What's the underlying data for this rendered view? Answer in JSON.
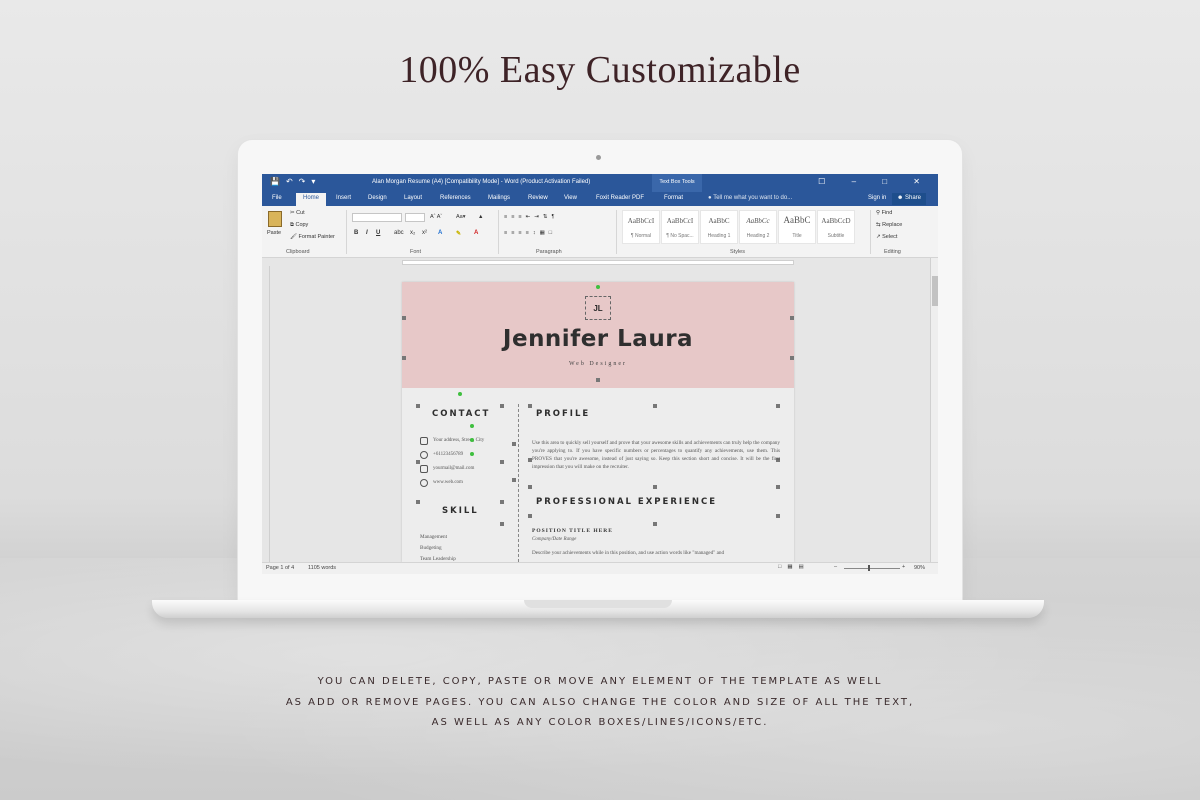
{
  "headline": "100% Easy Customizable",
  "captions": [
    "YOU CAN DELETE, COPY, PASTE OR MOVE ANY ELEMENT OF THE TEMPLATE AS WELL",
    "AS ADD OR REMOVE PAGES. YOU CAN ALSO CHANGE THE COLOR AND SIZE OF ALL THE TEXT,",
    "AS WELL AS ANY COLOR BOXES/LINES/ICONS/ETC."
  ],
  "word": {
    "title": "Alan Morgan Resume (A4) [Compatibility Mode] - Word (Product Activation Failed)",
    "context_tab": "Text Box Tools",
    "window_controls": "☐ – □ ✕",
    "tabs": [
      "File",
      "Home",
      "Insert",
      "Design",
      "Layout",
      "References",
      "Mailings",
      "Review",
      "View",
      "Foxit Reader PDF",
      "Format"
    ],
    "tell_me": "Tell me what you want to do...",
    "sign_in": "Sign in",
    "share": "Share",
    "clipboard": {
      "paste": "Paste",
      "cut": "Cut",
      "copy": "Copy",
      "format_painter": "Format Painter",
      "label": "Clipboard"
    },
    "font_label": "Font",
    "paragraph_label": "Paragraph",
    "styles_label": "Styles",
    "styles": [
      {
        "sample": "AaBbCcI",
        "name": "¶ Normal"
      },
      {
        "sample": "AaBbCcI",
        "name": "¶ No Spac..."
      },
      {
        "sample": "AaBbC",
        "name": "Heading 1"
      },
      {
        "sample": "AaBbCc",
        "name": "Heading 2"
      },
      {
        "sample": "AaBbC",
        "name": "Title"
      },
      {
        "sample": "AaBbCcD",
        "name": "Subtitle"
      }
    ],
    "editing": {
      "find": "Find",
      "replace": "Replace",
      "select": "Select",
      "label": "Editing"
    },
    "status": {
      "page": "Page 1 of 4",
      "words": "1105 words",
      "zoom": "90%"
    }
  },
  "resume": {
    "monogram": "JL",
    "name": "Jennifer Laura",
    "job_title": "Web Designer",
    "contact_heading": "CONTACT",
    "contact": [
      "Your address, Street, City",
      "+61123456789",
      "yourmail@mail.com",
      "www.web.com"
    ],
    "skill_heading": "SKILL",
    "skills": [
      "Management",
      "Budgeting",
      "Team Leadership"
    ],
    "profile_heading": "PROFILE",
    "profile_text": "Use this area to quickly sell yourself and prove that your awesome skills and achievements can truly help the company you're applying to. If you have specific numbers or percentages to quantify any achievements, use them. This PROVES that you're awesome, instead of just saying so. Keep this section short and concise. It will be the first impression that you will make on the recruiter.",
    "experience_heading": "PROFESSIONAL EXPERIENCE",
    "position_title": "POSITION TITLE HERE",
    "company": "Company/Date Range",
    "achievements": "Describe your achievements while in this position, and use action words like \"managed\" and"
  }
}
